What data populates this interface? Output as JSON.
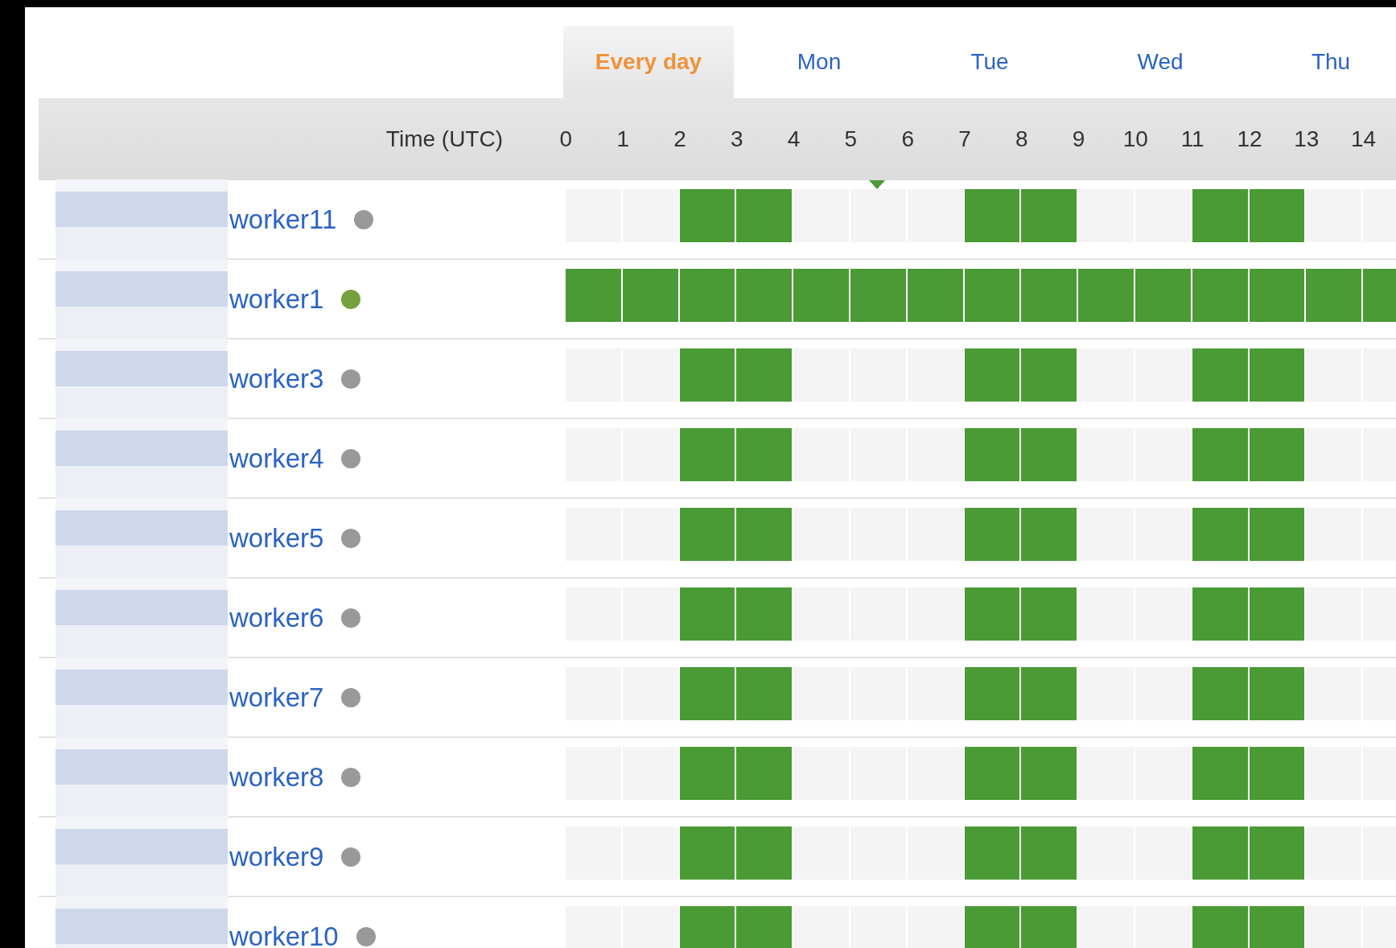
{
  "tabs": [
    {
      "label": "Every day",
      "selected": true
    },
    {
      "label": "Mon",
      "selected": false
    },
    {
      "label": "Tue",
      "selected": false
    },
    {
      "label": "Wed",
      "selected": false
    },
    {
      "label": "Thu",
      "selected": false
    }
  ],
  "header": {
    "time_label": "Time (UTC)",
    "hours": [
      "0",
      "1",
      "2",
      "3",
      "4",
      "5",
      "6",
      "7",
      "8",
      "9",
      "10",
      "11",
      "12",
      "13",
      "14"
    ]
  },
  "rows": [
    {
      "name": "worker11",
      "online": false,
      "slots": [
        false,
        false,
        true,
        true,
        false,
        false,
        false,
        true,
        true,
        false,
        false,
        true,
        true,
        false,
        false
      ]
    },
    {
      "name": "worker1",
      "online": true,
      "slots": [
        true,
        true,
        true,
        true,
        true,
        true,
        true,
        true,
        true,
        true,
        true,
        true,
        true,
        true,
        true
      ]
    },
    {
      "name": "worker3",
      "online": false,
      "slots": [
        false,
        false,
        true,
        true,
        false,
        false,
        false,
        true,
        true,
        false,
        false,
        true,
        true,
        false,
        false
      ]
    },
    {
      "name": "worker4",
      "online": false,
      "slots": [
        false,
        false,
        true,
        true,
        false,
        false,
        false,
        true,
        true,
        false,
        false,
        true,
        true,
        false,
        false
      ]
    },
    {
      "name": "worker5",
      "online": false,
      "slots": [
        false,
        false,
        true,
        true,
        false,
        false,
        false,
        true,
        true,
        false,
        false,
        true,
        true,
        false,
        false
      ]
    },
    {
      "name": "worker6",
      "online": false,
      "slots": [
        false,
        false,
        true,
        true,
        false,
        false,
        false,
        true,
        true,
        false,
        false,
        true,
        true,
        false,
        false
      ]
    },
    {
      "name": "worker7",
      "online": false,
      "slots": [
        false,
        false,
        true,
        true,
        false,
        false,
        false,
        true,
        true,
        false,
        false,
        true,
        true,
        false,
        false
      ]
    },
    {
      "name": "worker8",
      "online": false,
      "slots": [
        false,
        false,
        true,
        true,
        false,
        false,
        false,
        true,
        true,
        false,
        false,
        true,
        true,
        false,
        false
      ]
    },
    {
      "name": "worker9",
      "online": false,
      "slots": [
        false,
        false,
        true,
        true,
        false,
        false,
        false,
        true,
        true,
        false,
        false,
        true,
        true,
        false,
        false
      ]
    },
    {
      "name": "worker10",
      "online": false,
      "slots": [
        false,
        false,
        true,
        true,
        false,
        false,
        false,
        true,
        true,
        false,
        false,
        true,
        true,
        false,
        false
      ]
    }
  ]
}
